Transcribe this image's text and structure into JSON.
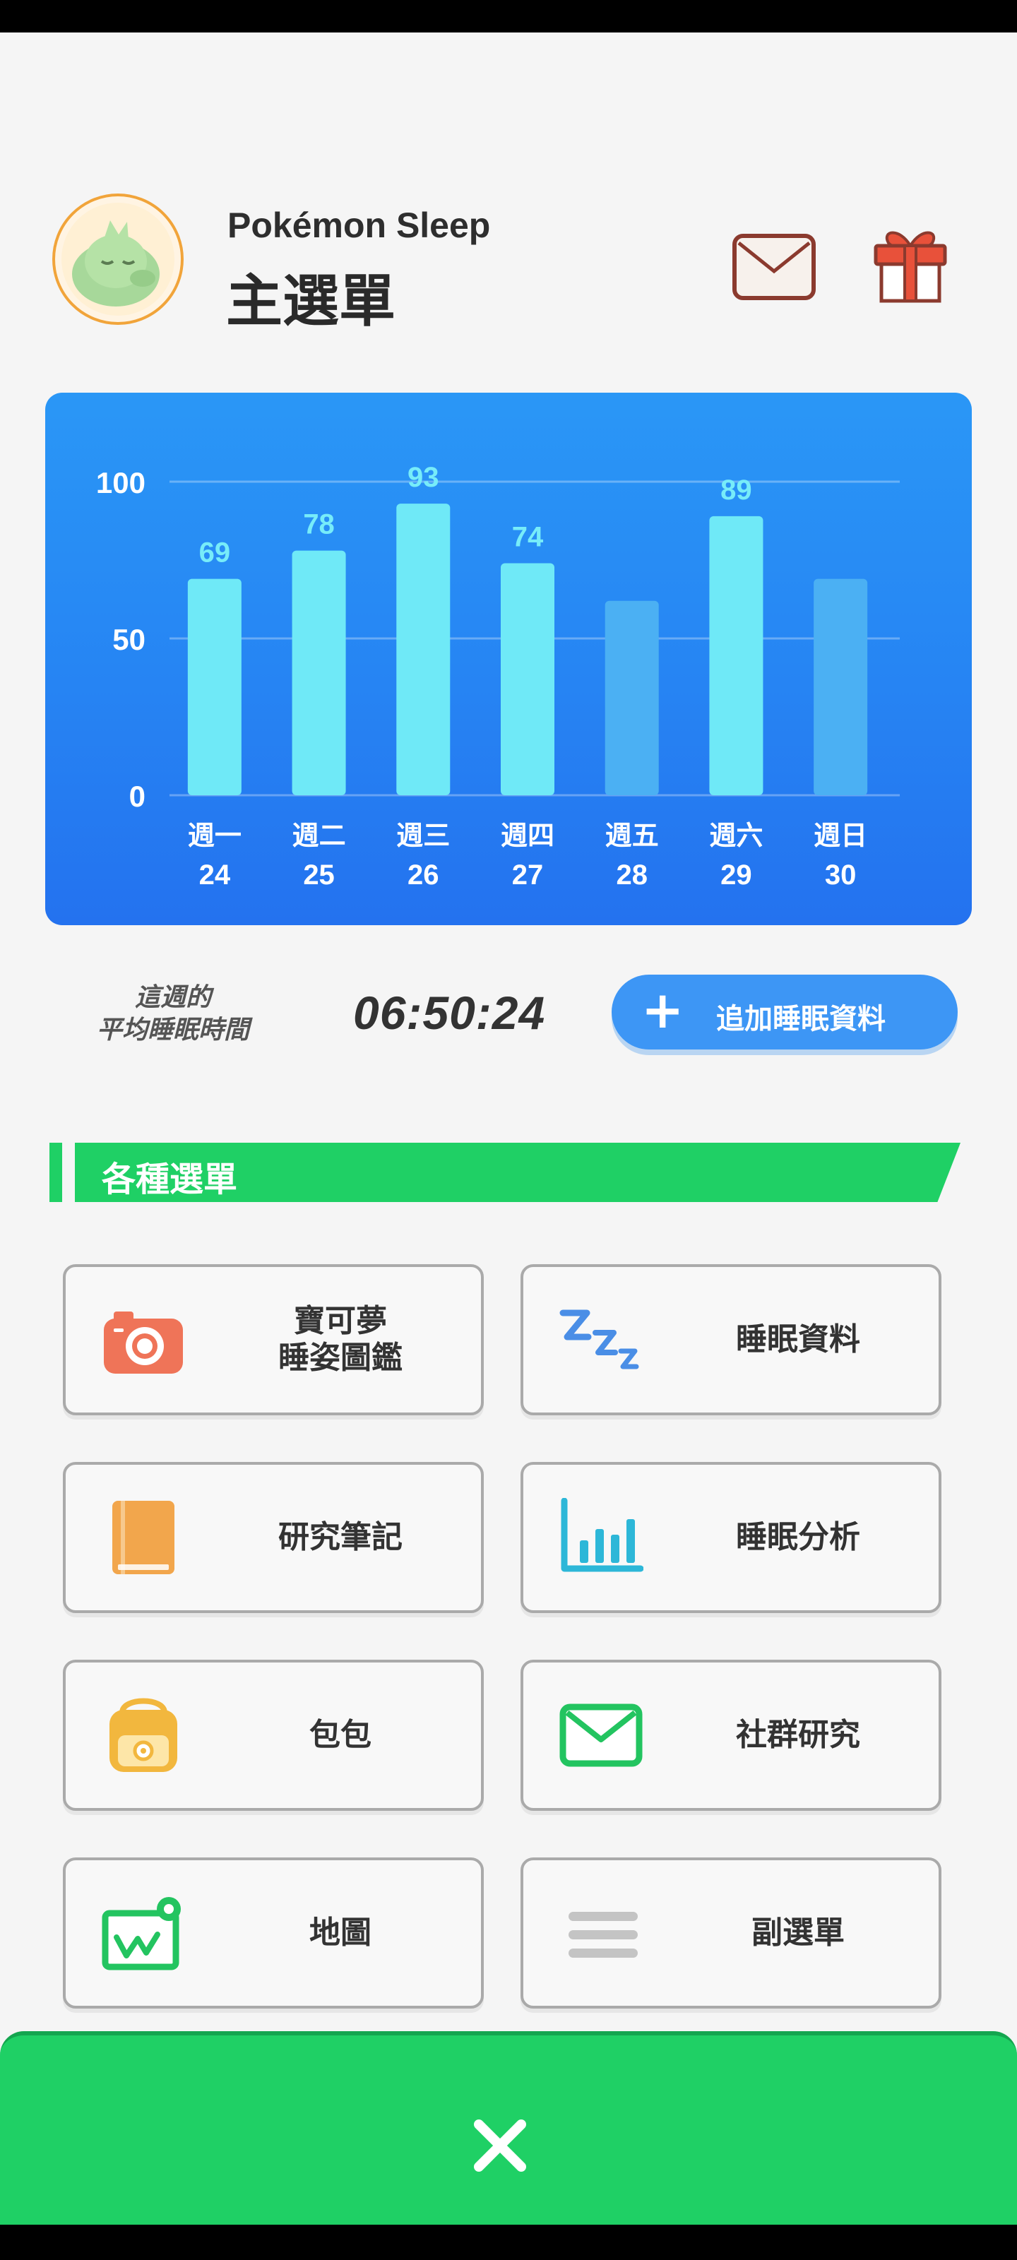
{
  "header": {
    "app_name": "Pokémon Sleep",
    "page_title": "主選單"
  },
  "chart_data": {
    "type": "bar",
    "categories": [
      "週一 24",
      "週二 25",
      "週三 26",
      "週四 27",
      "週五 28",
      "週六 29",
      "週日 30"
    ],
    "day_labels": [
      "週一",
      "週二",
      "週三",
      "週四",
      "週五",
      "週六",
      "週日"
    ],
    "date_labels": [
      "24",
      "25",
      "26",
      "27",
      "28",
      "29",
      "30"
    ],
    "values": [
      69,
      78,
      93,
      74,
      62,
      89,
      69
    ],
    "value_labels": [
      "69",
      "78",
      "93",
      "74",
      "",
      "89",
      ""
    ],
    "dimmed": [
      false,
      false,
      false,
      false,
      true,
      false,
      true
    ],
    "yticks": [
      0,
      50,
      100
    ],
    "ylim": [
      0,
      100
    ],
    "grid": true,
    "colors": {
      "bar": "#6fe9f7",
      "bar_dim": "#4bb0f3",
      "label": "#77ecf9",
      "text": "#ffffff"
    }
  },
  "summary": {
    "avg_label_line1": "這週的",
    "avg_label_line2": "平均睡眠時間",
    "avg_time": "06:50:24",
    "add_button_label": "追加睡眠資料"
  },
  "section": {
    "title": "各種選單"
  },
  "menu": [
    {
      "label": "寶可夢\n睡姿圖鑑",
      "icon": "camera-icon",
      "color": "#ef7458"
    },
    {
      "label": "睡眠資料",
      "icon": "zzz-icon",
      "color": "#4a8ee6"
    },
    {
      "label": "研究筆記",
      "icon": "notebook-icon",
      "color": "#ef9a4e"
    },
    {
      "label": "睡眠分析",
      "icon": "bar-chart-icon",
      "color": "#2db7d8"
    },
    {
      "label": "包包",
      "icon": "bag-icon",
      "color": "#f2b73e"
    },
    {
      "label": "社群研究",
      "icon": "mail-icon",
      "color": "#23c460"
    },
    {
      "label": "地圖",
      "icon": "map-icon",
      "color": "#23c460"
    },
    {
      "label": "副選單",
      "icon": "menu-icon",
      "color": "#a9a9a9"
    }
  ]
}
